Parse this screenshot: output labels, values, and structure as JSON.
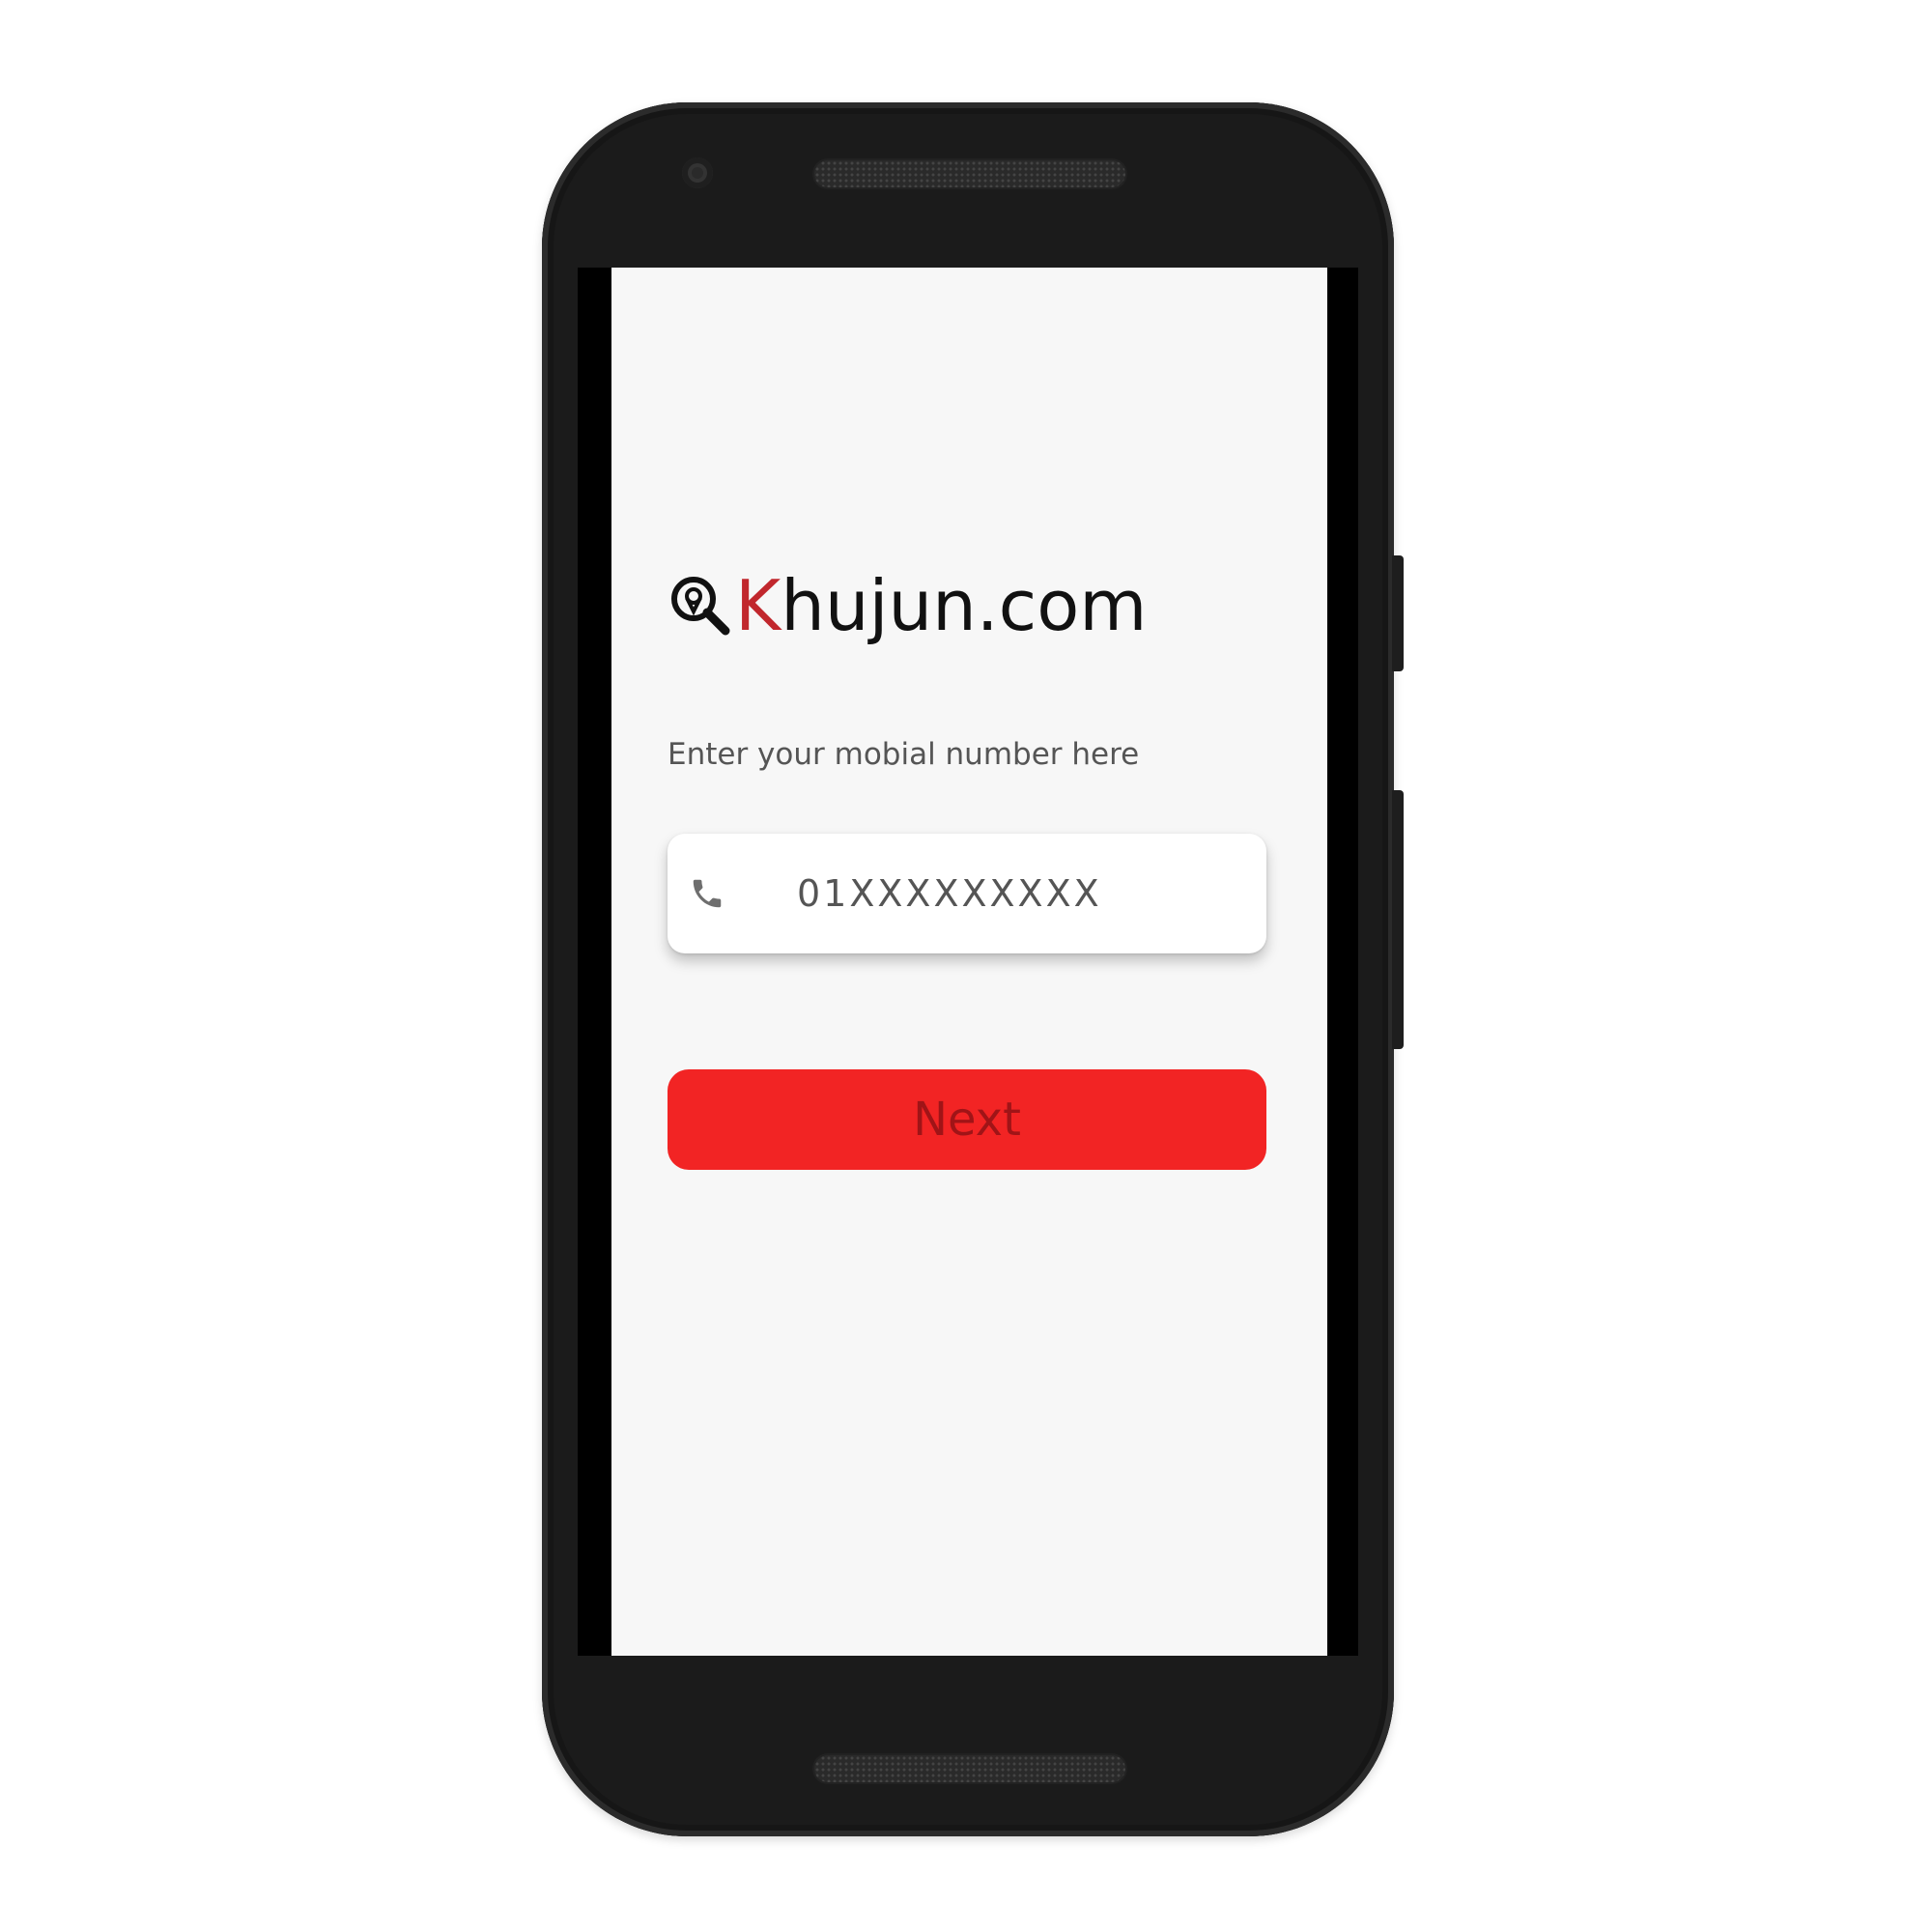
{
  "app": {
    "logo_letter_k": "K",
    "logo_rest": "hujun.com",
    "logo_icon": "search-location-icon",
    "brand_accent": "#c1272d"
  },
  "login": {
    "prompt": "Enter your mobial number here",
    "phone_placeholder": "01XXXXXXXXX",
    "phone_icon": "phone-icon",
    "next_label": "Next",
    "next_button_color": "#f22424",
    "next_text_color": "#a01417"
  }
}
